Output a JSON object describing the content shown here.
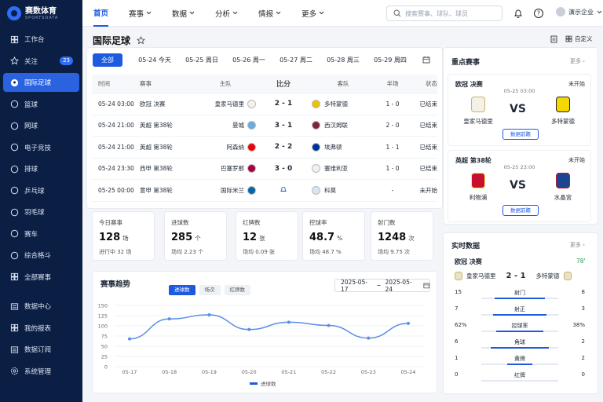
{
  "brand": {
    "name": "赛数体育",
    "sub": "SPORTSDATA"
  },
  "sidebar": {
    "items": [
      {
        "label": "工作台",
        "icon": "dashboard-icon"
      },
      {
        "label": "关注",
        "icon": "star-icon",
        "badge": "23"
      },
      {
        "label": "国际足球",
        "icon": "soccer-icon",
        "active": true
      },
      {
        "label": "篮球",
        "icon": "basketball-icon"
      },
      {
        "label": "网球",
        "icon": "tennis-icon"
      },
      {
        "label": "电子竞技",
        "icon": "gamepad-icon"
      },
      {
        "label": "排球",
        "icon": "volleyball-icon"
      },
      {
        "label": "乒乓球",
        "icon": "pingpong-icon"
      },
      {
        "label": "羽毛球",
        "icon": "badminton-icon"
      },
      {
        "label": "赛车",
        "icon": "flag-icon"
      },
      {
        "label": "综合格斗",
        "icon": "fight-icon"
      },
      {
        "label": "全部赛事",
        "icon": "menu-icon"
      }
    ],
    "items2": [
      {
        "label": "数据中心",
        "icon": "data-icon"
      },
      {
        "label": "我的报表",
        "icon": "report-icon"
      },
      {
        "label": "数据订阅",
        "icon": "subscribe-icon"
      },
      {
        "label": "系统管理",
        "icon": "settings-icon"
      }
    ]
  },
  "topnav": {
    "items": [
      "首页",
      "赛事",
      "数据",
      "分析",
      "情报",
      "更多"
    ],
    "search_placeholder": "搜索赛事、球队、球员",
    "user": "演示企业"
  },
  "page": {
    "title": "国际足球",
    "export": "",
    "customize": "自定义"
  },
  "date_tabs": [
    "全部",
    "05-24 今天",
    "05-25 周日",
    "05-26 周一",
    "05-27 周二",
    "05-28 周三",
    "05-29 周四"
  ],
  "table": {
    "headers": [
      "时间",
      "赛事",
      "主队",
      "比分",
      "客队",
      "半场",
      "状态"
    ],
    "rows": [
      {
        "time": "05-24 03:00",
        "comp": "欧冠 决赛",
        "home": "皇家马德里",
        "score": "2 - 1",
        "away": "多特蒙德",
        "half": "1 - 0",
        "status": "已结束"
      },
      {
        "time": "05-24 21:00",
        "comp": "英超 第38轮",
        "home": "曼城",
        "score": "3 - 1",
        "away": "西汉姆联",
        "half": "2 - 0",
        "status": "已结束"
      },
      {
        "time": "05-24 21:00",
        "comp": "英超 第38轮",
        "home": "阿森纳",
        "score": "2 - 2",
        "away": "埃弗顿",
        "half": "1 - 1",
        "status": "已结束"
      },
      {
        "time": "05-24 23:30",
        "comp": "西甲 第38轮",
        "home": "巴塞罗那",
        "score": "3 - 0",
        "away": "塞维利亚",
        "half": "1 - 0",
        "status": "已结束"
      },
      {
        "time": "05-25 00:00",
        "comp": "意甲 第38轮",
        "home": "国际米兰",
        "score": "",
        "away": "科莫",
        "half": "-",
        "status": "未开始"
      }
    ]
  },
  "stats": [
    {
      "label": "今日赛事",
      "value": "128",
      "unit": "场",
      "sub": "进行中 32 场"
    },
    {
      "label": "进球数",
      "value": "285",
      "unit": "个",
      "sub": "场均 2.23 个"
    },
    {
      "label": "红牌数",
      "value": "12",
      "unit": "张",
      "sub": "场均 0.09 张"
    },
    {
      "label": "控球率",
      "value": "48.7",
      "unit": "%",
      "sub": "场均 48.7 %"
    },
    {
      "label": "射门数",
      "value": "1248",
      "unit": "次",
      "sub": "场均 9.75 次"
    }
  ],
  "trend": {
    "title": "赛事趋势",
    "chips": [
      "进球数",
      "场次",
      "红牌数"
    ],
    "date_from": "2025-05-17",
    "date_sep": "~",
    "date_to": "2025-05-24"
  },
  "chart_data": {
    "type": "line",
    "categories": [
      "05-17",
      "05-18",
      "05-19",
      "05-20",
      "05-21",
      "05-22",
      "05-23",
      "05-24"
    ],
    "series": [
      {
        "name": "进球数",
        "values": [
          68,
          117,
          127,
          91,
          109,
          101,
          70,
          106
        ]
      }
    ],
    "ylim": [
      0,
      150
    ],
    "yticks": [
      0,
      25,
      50,
      75,
      100,
      125,
      150
    ],
    "grid": true,
    "legend": "bottom",
    "color": "#5b8ee6"
  },
  "featured": {
    "title": "重点赛事",
    "more": "更多",
    "matches": [
      {
        "league": "欧冠 决赛",
        "status": "未开始",
        "time": "05-25 03:00",
        "home": "皇家马德里",
        "away": "多特蒙德",
        "vs": "VS",
        "button": "数据前瞻"
      },
      {
        "league": "英超 第38轮",
        "status": "未开始",
        "time": "05-25 23:00",
        "home": "利物浦",
        "away": "水晶宫",
        "vs": "VS",
        "button": "数据前瞻"
      }
    ]
  },
  "live": {
    "title": "实时数据",
    "more": "更多",
    "league": "欧冠 决赛",
    "minute": "78'",
    "home": "皇家马德里",
    "score": "2 - 1",
    "away": "多特蒙德",
    "rows": [
      {
        "home": "15",
        "label": "射门",
        "away": "8",
        "hf": 0.65
      },
      {
        "home": "7",
        "label": "射正",
        "away": "3",
        "hf": 0.7
      },
      {
        "home": "62%",
        "label": "控球率",
        "away": "38%",
        "hf": 0.62
      },
      {
        "home": "6",
        "label": "角球",
        "away": "2",
        "hf": 0.75
      },
      {
        "home": "1",
        "label": "黄牌",
        "away": "2",
        "hf": 0.33
      },
      {
        "home": "0",
        "label": "红牌",
        "away": "0",
        "hf": 0.0
      }
    ]
  }
}
